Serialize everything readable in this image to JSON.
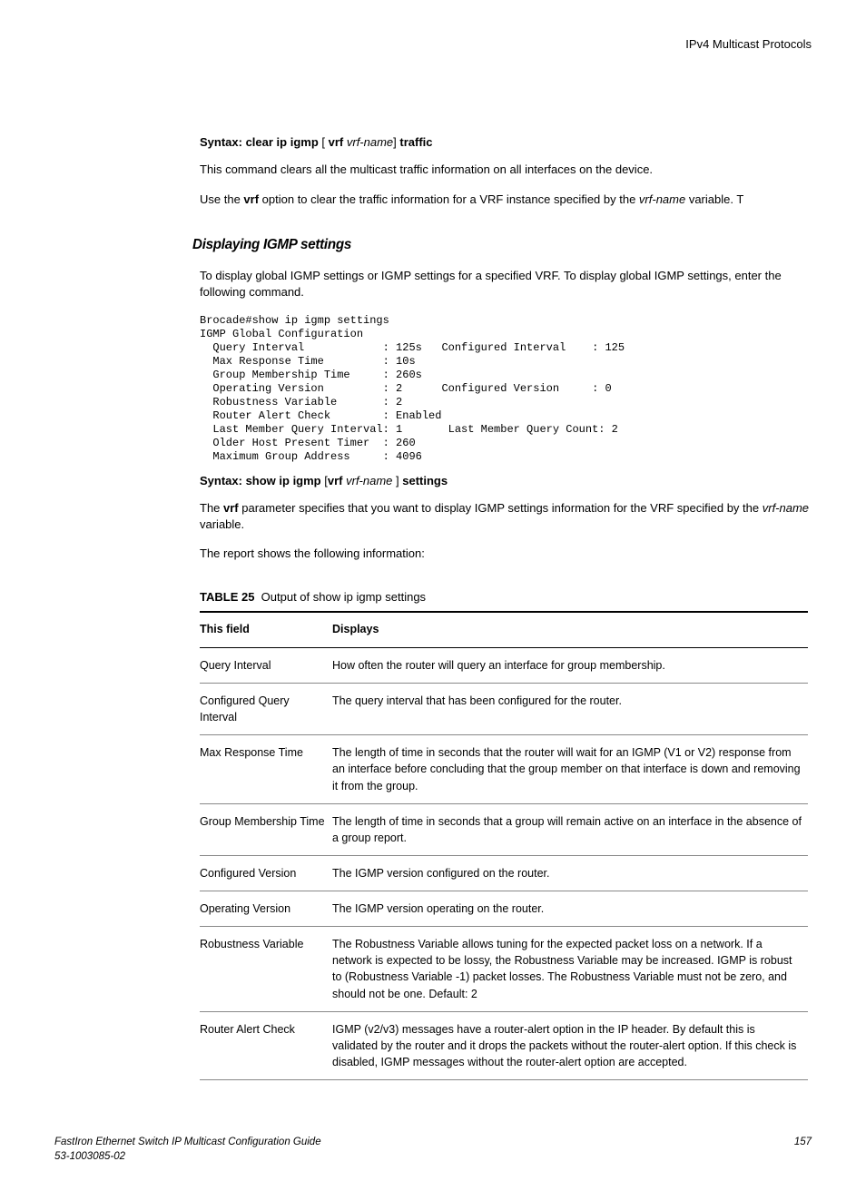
{
  "header": {
    "title": "IPv4 Multicast Protocols"
  },
  "syntax1": {
    "prefix": "Syntax: clear ip igmp",
    "bracket_open": " [ ",
    "vrf": "vrf",
    "space": " ",
    "vrfname": "vrf-name",
    "bracket_close": "] ",
    "suffix": "traffic"
  },
  "para1": "This command clears all the multicast traffic information on all interfaces on the device.",
  "para2a": "Use the ",
  "para2b": "vrf",
  "para2c": " option to clear the traffic information for a VRF instance specified by the ",
  "para2d": "vrf-name",
  "para2e": " variable. T",
  "heading": "Displaying IGMP settings",
  "para3": "To display global IGMP settings or IGMP settings for a specified VRF. To display global IGMP settings, enter the following command.",
  "code": "Brocade#show ip igmp settings\nIGMP Global Configuration\n  Query Interval            : 125s   Configured Interval    : 125\n  Max Response Time         : 10s\n  Group Membership Time     : 260s\n  Operating Version         : 2      Configured Version     : 0\n  Robustness Variable       : 2\n  Router Alert Check        : Enabled\n  Last Member Query Interval: 1       Last Member Query Count: 2\n  Older Host Present Timer  : 260\n  Maximum Group Address     : 4096",
  "syntax2": {
    "prefix": "Syntax: show ip igmp",
    "bracket_open": " [",
    "vrf": "vrf",
    "space": " ",
    "vrfname": "vrf-name",
    "bracket_close": " ] ",
    "suffix": "settings"
  },
  "para4a": "The ",
  "para4b": "vrf",
  "para4c": " parameter specifies that you want to display IGMP settings information for the VRF specified by the ",
  "para4d": "vrf-name",
  "para4e": " variable.",
  "para5": "The report shows the following information:",
  "table": {
    "caption_label": "TABLE 25",
    "caption_text": "Output of show ip igmp settings",
    "header": {
      "col1": "This field",
      "col2": "Displays"
    },
    "rows": [
      {
        "field": "Query Interval",
        "desc": "How often the router will query an interface for group membership."
      },
      {
        "field": "Configured Query Interval",
        "desc": "The query interval that has been configured for the router."
      },
      {
        "field": "Max Response Time",
        "desc": "The length of time in seconds that the router will wait for an IGMP (V1 or V2) response from an interface before concluding that the group member on that interface is down and removing it from the group."
      },
      {
        "field": "Group Membership Time",
        "desc": "The length of time in seconds that a group will remain active on an interface in the absence of a group report."
      },
      {
        "field": "Configured Version",
        "desc": "The IGMP version configured on the router."
      },
      {
        "field": "Operating Version",
        "desc": "The IGMP version operating on the router."
      },
      {
        "field": "Robustness Variable",
        "desc": "The Robustness Variable allows tuning for the expected packet loss on a network. If a network is expected to be lossy, the Robustness Variable may be increased. IGMP is robust to (Robustness Variable -1) packet losses. The Robustness Variable must not be zero, and should not be one. Default: 2"
      },
      {
        "field": "Router Alert Check",
        "desc": "IGMP (v2/v3) messages have a router-alert option in the IP header. By default this is validated by the router and it drops the packets without the router-alert option. If this check is disabled, IGMP messages without the router-alert option are accepted."
      }
    ]
  },
  "footer": {
    "line1": "FastIron Ethernet Switch IP Multicast Configuration Guide",
    "line2": "53-1003085-02",
    "page": "157"
  }
}
